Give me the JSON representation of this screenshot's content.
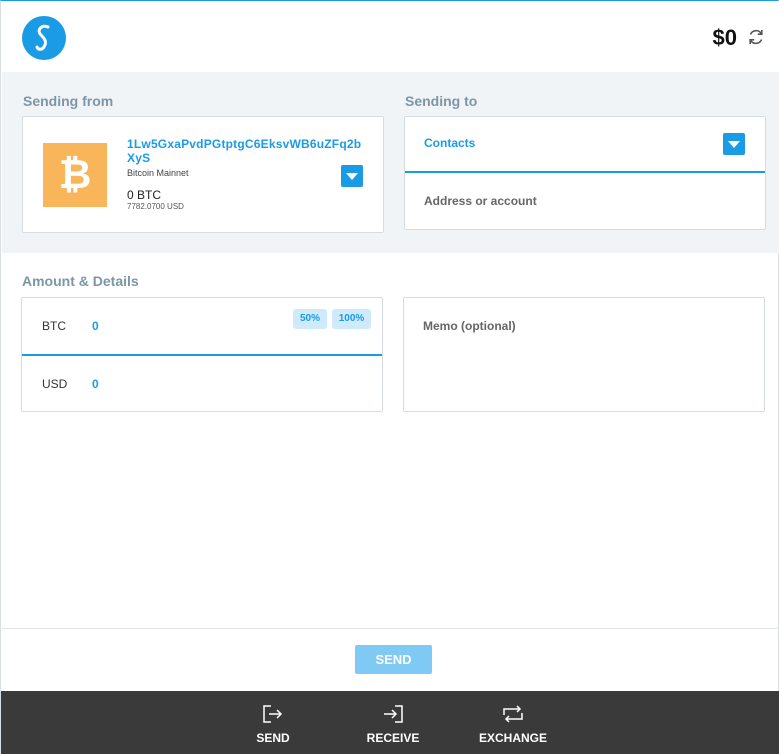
{
  "header": {
    "logo_icon": "wallet-logo-s",
    "balance": "$0",
    "refresh_icon": "refresh-icon"
  },
  "sending_from": {
    "label": "Sending from",
    "address": "1Lw5GxaPvdPGtptgC6EksvWB6uZFq2bXyS",
    "network": "Bitcoin Mainnet",
    "btc_balance": "0 BTC",
    "usd_balance": "7782.0700 USD",
    "coin_icon": "bitcoin-icon",
    "coin_color": "#f9b55a"
  },
  "sending_to": {
    "label": "Sending to",
    "contacts_label": "Contacts",
    "address_placeholder": "Address or account"
  },
  "amount_details": {
    "label": "Amount & Details",
    "btc_label": "BTC",
    "btc_value": "0",
    "usd_label": "USD",
    "usd_value": "0",
    "btn_50": "50%",
    "btn_100": "100%",
    "memo_placeholder": "Memo (optional)"
  },
  "send_button": "SEND",
  "nav": {
    "send": "SEND",
    "receive": "RECEIVE",
    "exchange": "EXCHANGE"
  },
  "colors": {
    "accent": "#1a9be6",
    "band": "#f1f4f6",
    "nav_bg": "#3a3a3a"
  }
}
